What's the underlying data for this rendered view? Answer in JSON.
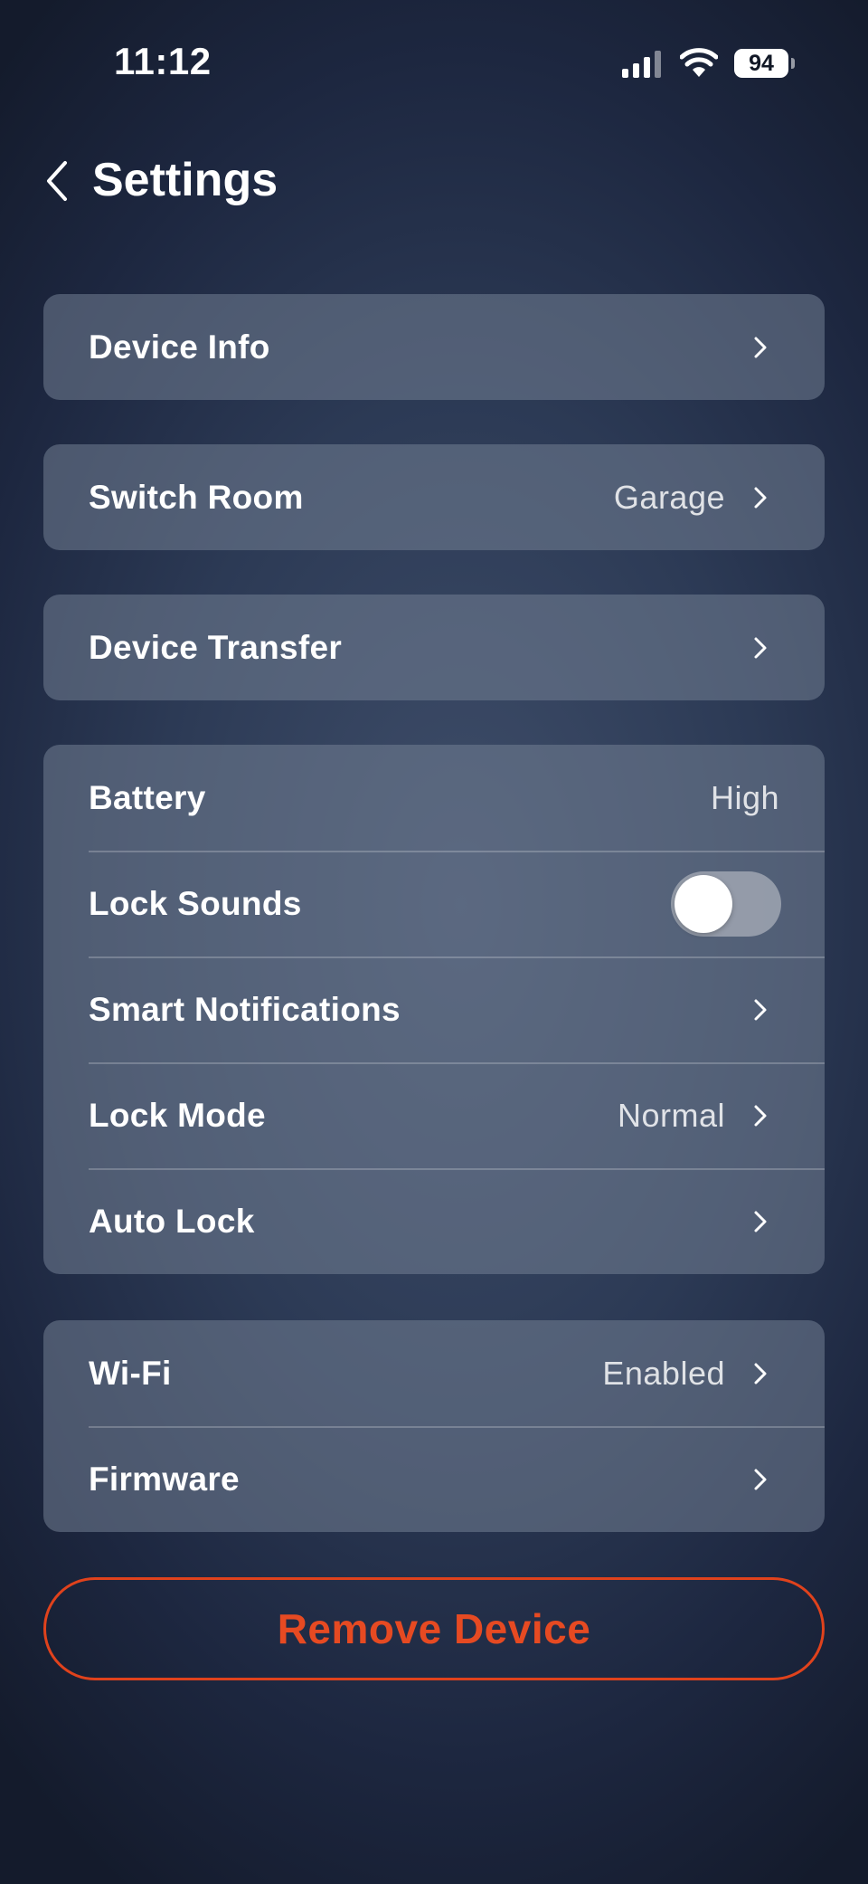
{
  "status_bar": {
    "time": "11:12",
    "battery_level": "94",
    "signal_icon": "cellular-signal-icon",
    "wifi_icon": "wifi-icon",
    "battery_icon": "battery-icon"
  },
  "header": {
    "back_icon": "chevron-left-icon",
    "title": "Settings"
  },
  "cards": {
    "device_info": {
      "label": "Device Info"
    },
    "switch_room": {
      "label": "Switch Room",
      "value": "Garage"
    },
    "device_transfer": {
      "label": "Device Transfer"
    },
    "device_settings": {
      "battery": {
        "label": "Battery",
        "value": "High"
      },
      "lock_sounds": {
        "label": "Lock Sounds",
        "toggle_on": false
      },
      "smart_notifications": {
        "label": "Smart Notifications"
      },
      "lock_mode": {
        "label": "Lock Mode",
        "value": "Normal"
      },
      "auto_lock": {
        "label": "Auto Lock"
      }
    },
    "network": {
      "wifi": {
        "label": "Wi-Fi",
        "value": "Enabled"
      },
      "firmware": {
        "label": "Firmware"
      }
    }
  },
  "remove_button": {
    "label": "Remove Device"
  },
  "colors": {
    "accent_danger": "#e64a22",
    "card_background": "#5b6780",
    "toggle_off": "#a7abb4"
  }
}
